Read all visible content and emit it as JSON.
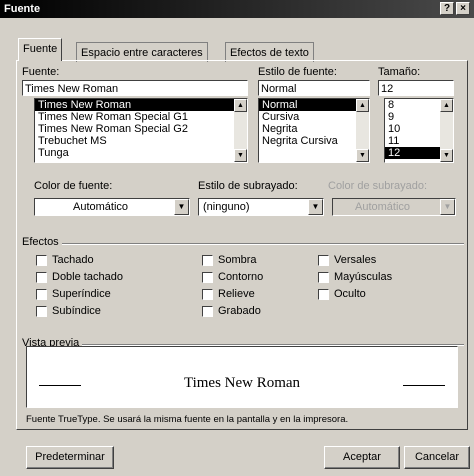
{
  "window": {
    "title": "Fuente",
    "help_button": "?",
    "close_button": "×"
  },
  "tabs": [
    {
      "label": "Fuente"
    },
    {
      "label": "Espacio entre caracteres"
    },
    {
      "label": "Efectos de texto"
    }
  ],
  "font": {
    "label": "Fuente:",
    "value": "Times New Roman",
    "options": [
      "Times New Roman",
      "Times New Roman Special G1",
      "Times New Roman Special G2",
      "Trebuchet MS",
      "Tunga"
    ],
    "selected_index": 0
  },
  "style": {
    "label": "Estilo de fuente:",
    "value": "Normal",
    "options": [
      "Normal",
      "Cursiva",
      "Negrita",
      "Negrita Cursiva"
    ],
    "selected_index": 0
  },
  "size": {
    "label": "Tamaño:",
    "value": "12",
    "options": [
      "8",
      "9",
      "10",
      "11",
      "12"
    ],
    "selected_index": 4
  },
  "font_color": {
    "label": "Color de fuente:",
    "value": "Automático"
  },
  "underline_style": {
    "label": "Estilo de subrayado:",
    "value": "(ninguno)"
  },
  "underline_color": {
    "label": "Color de subrayado:",
    "value": "Automático"
  },
  "effects": {
    "label": "Efectos",
    "items": [
      {
        "label": "Tachado",
        "checked": false
      },
      {
        "label": "Doble tachado",
        "checked": false
      },
      {
        "label": "Superíndice",
        "checked": false
      },
      {
        "label": "Subíndice",
        "checked": false
      },
      {
        "label": "Sombra",
        "checked": false
      },
      {
        "label": "Contorno",
        "checked": false
      },
      {
        "label": "Relieve",
        "checked": false
      },
      {
        "label": "Grabado",
        "checked": false
      },
      {
        "label": "Versales",
        "checked": false
      },
      {
        "label": "Mayúsculas",
        "checked": false
      },
      {
        "label": "Oculto",
        "checked": false
      }
    ]
  },
  "preview": {
    "label": "Vista previa",
    "sample_text": "Times New Roman",
    "note": "Fuente TrueType. Se usará la misma fuente en la pantalla y en la impresora."
  },
  "buttons": {
    "default": "Predeterminar",
    "ok": "Aceptar",
    "cancel": "Cancelar"
  }
}
